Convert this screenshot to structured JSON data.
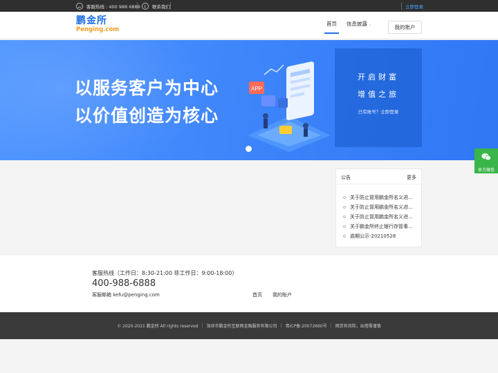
{
  "topbar": {
    "hotline_label": "客服热线 : 400 988 6888",
    "contact_label": "联系我们",
    "login_label": "立即登录"
  },
  "header": {
    "logo_cn": "鹏金所",
    "logo_en": "Penging.com",
    "nav": [
      {
        "label": "首页",
        "active": true
      },
      {
        "label": "信息披露",
        "has_dropdown": true
      },
      {
        "label": "我的账户"
      }
    ]
  },
  "banner": {
    "slogan_line1": "以服务客户为中心",
    "slogan_line2": "以价值创造为核心",
    "illustration_text": "APP",
    "promo_line1": "开启财富",
    "promo_line2": "增值之旅",
    "promo_login": "已有账号？立即登录"
  },
  "side": {
    "wechat_label": "官方微信"
  },
  "notice": {
    "title": "公告",
    "more": "更多",
    "items": [
      "关于防止冒用鹏金所名义进行诈骗的声明",
      "关于防止冒用鹏金所名义进行诈骗的声明",
      "关于防止冒用鹏金所名义进行诈骗的声明",
      "关于鹏金所终止银行存管事项的公告",
      "逾期公示-20210528"
    ]
  },
  "footer": {
    "hotline_label": "客服热线（工作日：8:30-21:00    非工作日：9:00-18:00）",
    "hotline_number": "400-988-6888",
    "email": "客服邮箱 kefu@penging.com",
    "links": [
      "首页",
      "我的账户"
    ]
  },
  "copyright": {
    "part1": "© 2020-2021  鹏金所  All rights reserved",
    "part2": "深圳市鹏金所互联网金融服务有限公司",
    "part3": "粤ICP备:20072660号",
    "part4": "网贷有风险，出借需谨慎"
  },
  "colors": {
    "brand_blue": "#1d6fe0",
    "brand_orange": "#f29a1f",
    "banner_blue": "#3f86fb",
    "wechat_green": "#39b54a"
  }
}
